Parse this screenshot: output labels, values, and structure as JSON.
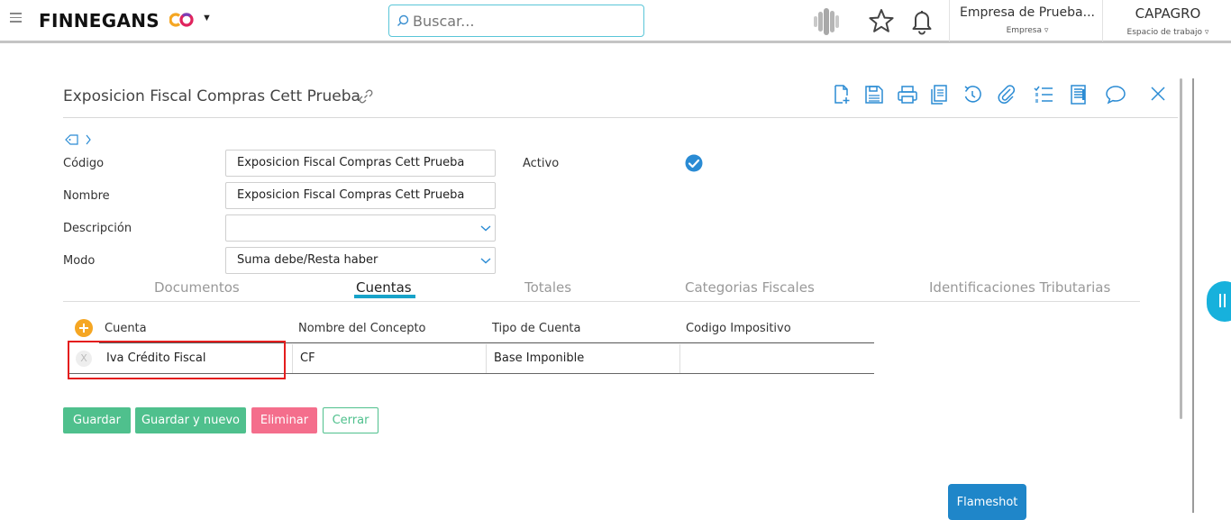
{
  "header": {
    "logo_text": "FINNEGANS",
    "logo_suffix": "CO",
    "search_placeholder": "Buscar...",
    "company_name": "Empresa de Prueba...",
    "company_label": "Empresa ▿",
    "workspace_name": "CAPAGRO",
    "workspace_label": "Espacio de trabajo ▿"
  },
  "form": {
    "title": "Exposicion Fiscal Compras Cett Prueba",
    "codigo_label": "Código",
    "codigo_value": "Exposicion Fiscal Compras Cett Prueba",
    "nombre_label": "Nombre",
    "nombre_value": "Exposicion Fiscal Compras Cett Prueba",
    "descripcion_label": "Descripción",
    "descripcion_value": "",
    "modo_label": "Modo",
    "modo_value": "Suma debe/Resta haber",
    "activo_label": "Activo",
    "activo_checked": true
  },
  "tabs": [
    "Documentos",
    "Cuentas",
    "Totales",
    "Categorias Fiscales",
    "Identificaciones Tributarias"
  ],
  "active_tab": "Cuentas",
  "grid": {
    "headers": [
      "Cuenta",
      "Nombre del Concepto",
      "Tipo de Cuenta",
      "Codigo Impositivo"
    ],
    "rows": [
      {
        "delete": "X",
        "cuenta": "Iva Crédito Fiscal",
        "concepto": "CF",
        "tipo": "Base Imponible",
        "codigo": ""
      }
    ]
  },
  "buttons": {
    "guardar": "Guardar",
    "guardar_nuevo": "Guardar y nuevo",
    "eliminar": "Eliminar",
    "cerrar": "Cerrar"
  },
  "colors": {
    "accent": "#17a3c9",
    "primary_button": "#4fc08d",
    "danger_button": "#f46e8c",
    "icon_blue": "#2a8bd4",
    "highlight": "#e41d1d"
  },
  "flameshot_label": "Flameshot"
}
